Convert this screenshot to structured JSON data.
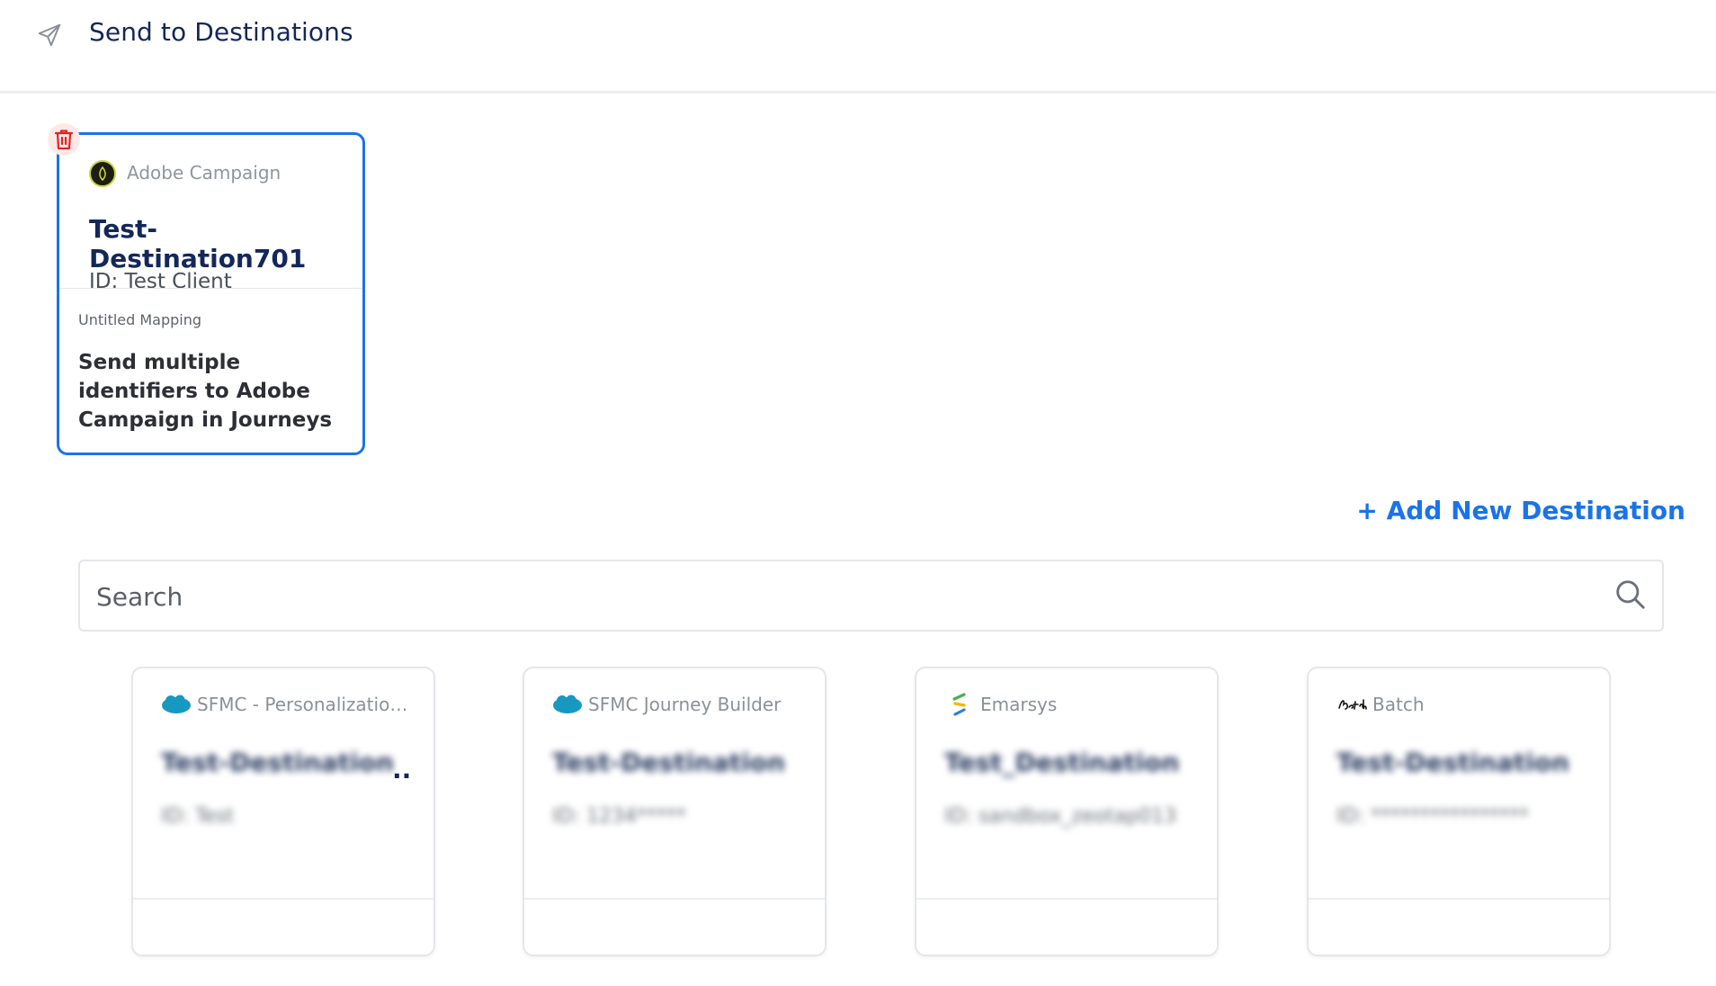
{
  "header": {
    "title": "Send to Destinations",
    "icon": "send-icon"
  },
  "selected": {
    "provider": "Adobe Campaign",
    "title": "Test-Destination701",
    "id_text": "ID: Test Client",
    "mapping_label": "Untitled Mapping",
    "mapping_title": "Send multiple identifiers to Adobe Campaign in Journeys"
  },
  "add_destination_label": "+ Add New Destination",
  "search": {
    "placeholder": "Search"
  },
  "destinations": [
    {
      "provider": "SFMC - Personalization ...",
      "name": "Test-Destination12...",
      "id_text": "ID: Test",
      "logo": "salesforce-icon"
    },
    {
      "provider": "SFMC Journey Builder",
      "name": "Test-Destination0",
      "id_text": "ID: 1234*****",
      "logo": "salesforce-icon"
    },
    {
      "provider": "Emarsys",
      "name": "Test_Destination_...",
      "id_text": "ID: sandbox_zeotap013",
      "logo": "emarsys-icon"
    },
    {
      "provider": "Batch",
      "name": "Test-Destination12...",
      "id_text": "ID: ****************",
      "logo": "batch-icon"
    }
  ],
  "colors": {
    "accent": "#1a73e8",
    "title": "#14275a",
    "danger": "#e02424"
  }
}
